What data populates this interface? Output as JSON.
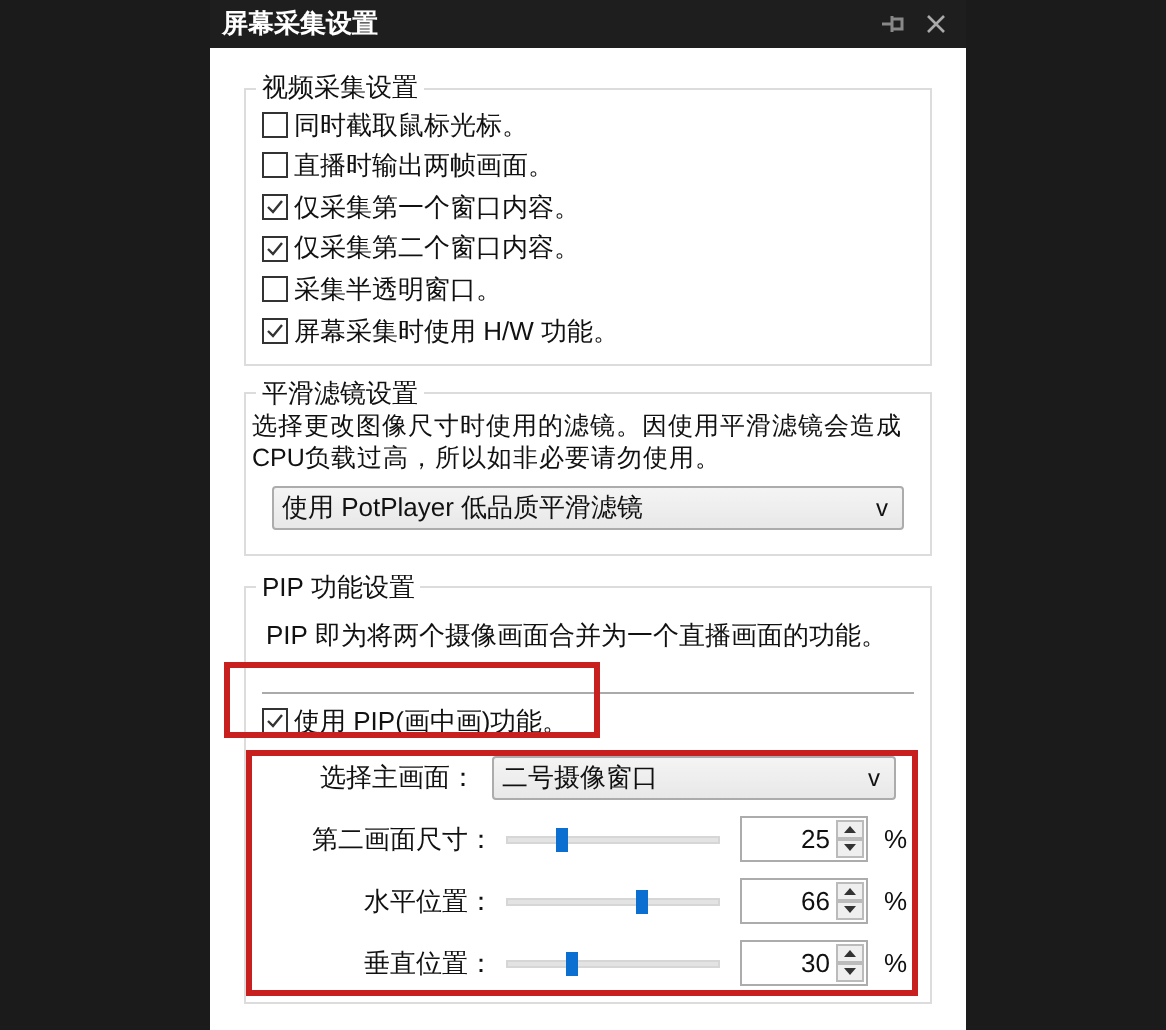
{
  "window": {
    "title": "屏幕采集设置"
  },
  "video_capture": {
    "title": "视频采集设置",
    "options": [
      {
        "label": "同时截取鼠标光标。",
        "checked": false
      },
      {
        "label": "直播时输出两帧画面。",
        "checked": false
      },
      {
        "label": "仅采集第一个窗口内容。",
        "checked": true
      },
      {
        "label": "仅采集第二个窗口内容。",
        "checked": true
      },
      {
        "label": "采集半透明窗口。",
        "checked": false
      },
      {
        "label": "屏幕采集时使用 H/W 功能。",
        "checked": true
      }
    ]
  },
  "smoothing_filter": {
    "title": "平滑滤镜设置",
    "description": "选择更改图像尺寸时使用的滤镜。因使用平滑滤镜会造成CPU负载过高，所以如非必要请勿使用。",
    "dropdown": {
      "value": "使用 PotPlayer 低品质平滑滤镜",
      "arrow": "v"
    }
  },
  "pip": {
    "title": "PIP 功能设置",
    "description": "PIP 即为将两个摄像画面合并为一个直播画面的功能。",
    "enable": {
      "label": "使用 PIP(画中画)功能。",
      "checked": true
    },
    "main_view": {
      "label": "选择主画面：",
      "value": "二号摄像窗口",
      "arrow": "v"
    },
    "sliders": [
      {
        "label": "第二画面尺寸：",
        "level": 0.26,
        "value": "25",
        "unit": "%"
      },
      {
        "label": "水平位置：",
        "level": 0.64,
        "value": "66",
        "unit": "%"
      },
      {
        "label": "垂直位置：",
        "level": 0.3,
        "value": "30",
        "unit": "%"
      }
    ]
  }
}
